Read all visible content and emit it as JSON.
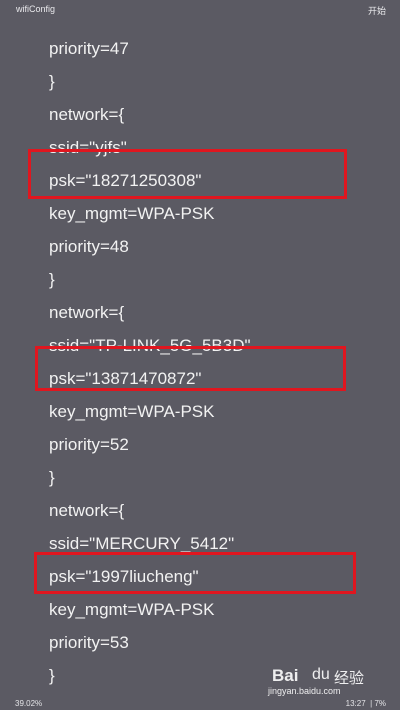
{
  "header": {
    "app_title": "wifiConfig",
    "action_label": "开始"
  },
  "config_lines": [
    "priority=47",
    "}",
    "network={",
    "ssid=\"yjfs\"",
    "psk=\"18271250308\"",
    "key_mgmt=WPA-PSK",
    "priority=48",
    "}",
    "network={",
    "ssid=\"TP-LINK_5G_5B3D\"",
    "psk=\"13871470872\"",
    "key_mgmt=WPA-PSK",
    "priority=52",
    "}",
    "network={",
    "ssid=\"MERCURY_5412\"",
    "psk=\"1997liucheng\"",
    "key_mgmt=WPA-PSK",
    "priority=53",
    "}"
  ],
  "footer": {
    "scroll_percent": "39.02%",
    "time": "13:27",
    "battery": "7%"
  },
  "watermark": {
    "brand": "Bai",
    "paw": "du",
    "cn": "经验",
    "url": "jingyan.baidu.com"
  },
  "colors": {
    "background": "#5b5a63",
    "highlight": "#e0161f",
    "text": "#f2f2f2"
  }
}
